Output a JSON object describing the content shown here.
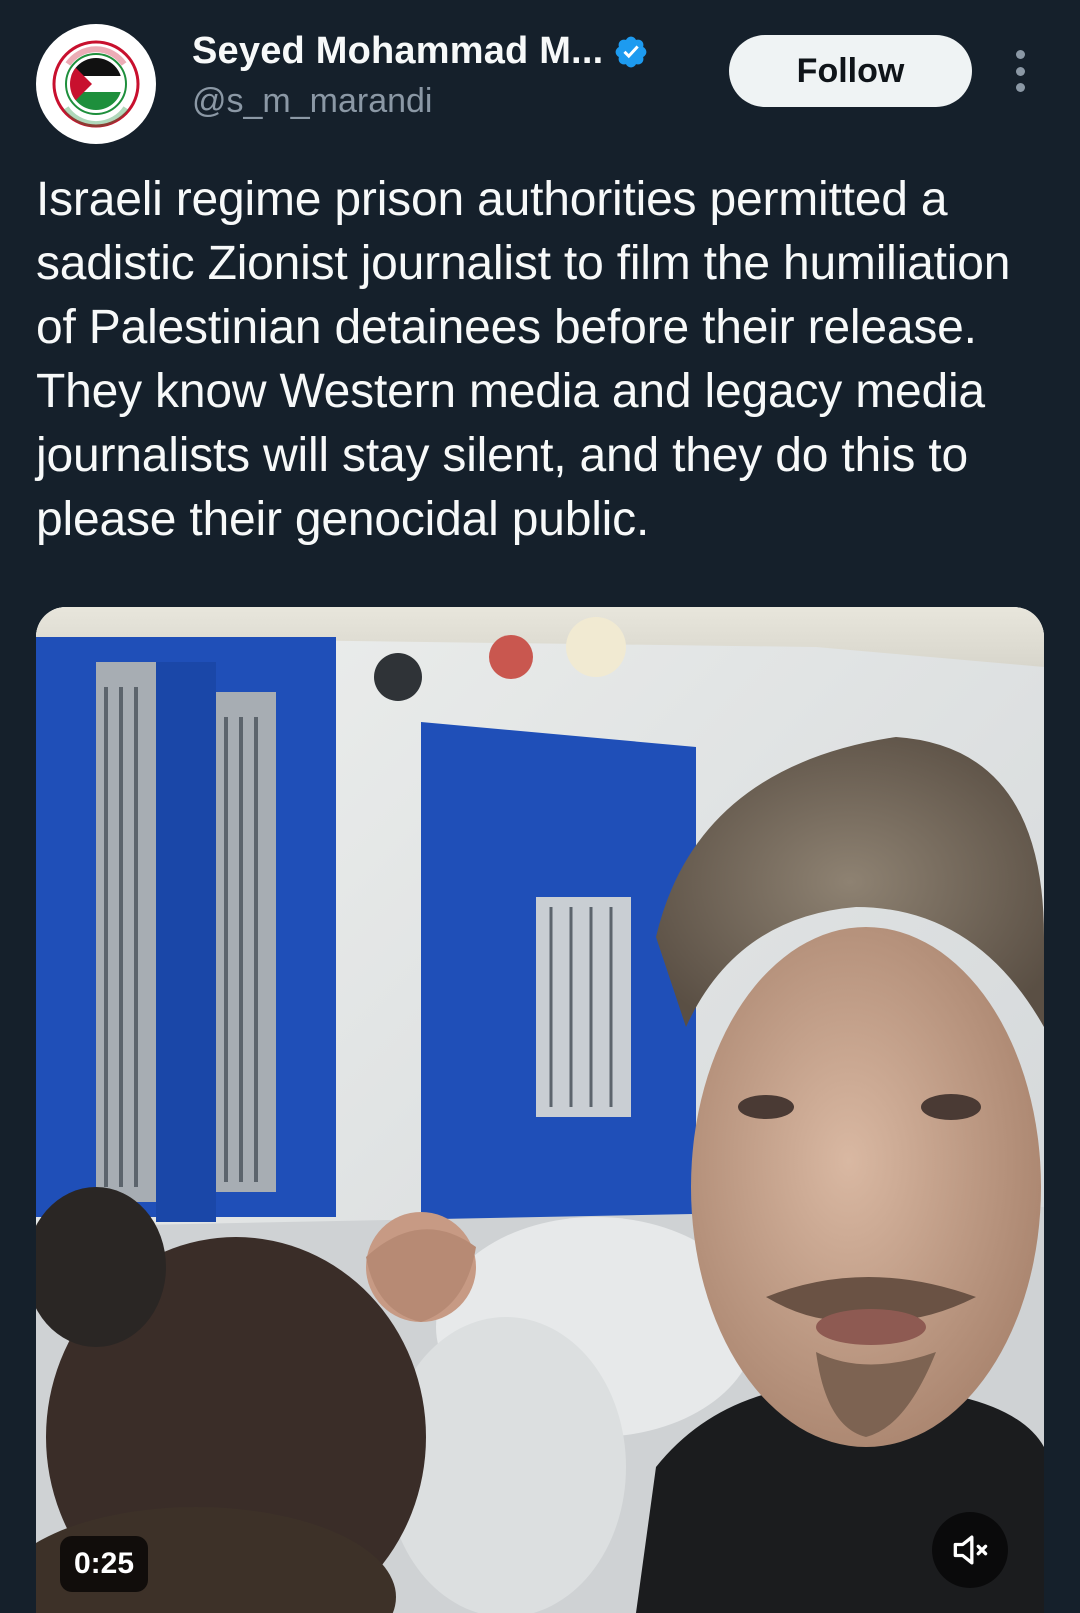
{
  "author": {
    "display_name": "Seyed Mohammad M...",
    "handle": "@s_m_marandi",
    "verified": true,
    "avatar_badge_top": "SAVE GAZA",
    "avatar_badge_bottom": "SAVE PALESTINE"
  },
  "actions": {
    "follow_label": "Follow",
    "more_icon": "more-vertical-icon"
  },
  "tweet": {
    "text": "Israeli regime prison authorities permitted a sadistic Zionist journalist to film the humiliation of Palestinian detainees before their release. They know Western media and legacy media journalists will stay silent, and they do this to please their genocidal public."
  },
  "video": {
    "duration": "0:25",
    "mute_icon": "volume-muted-icon"
  },
  "colors": {
    "background": "#15202b",
    "primary_text": "#f7f9f9",
    "secondary_text": "#8b98a5",
    "verified_blue": "#1d9bf0",
    "follow_button_bg": "#eff3f4"
  }
}
